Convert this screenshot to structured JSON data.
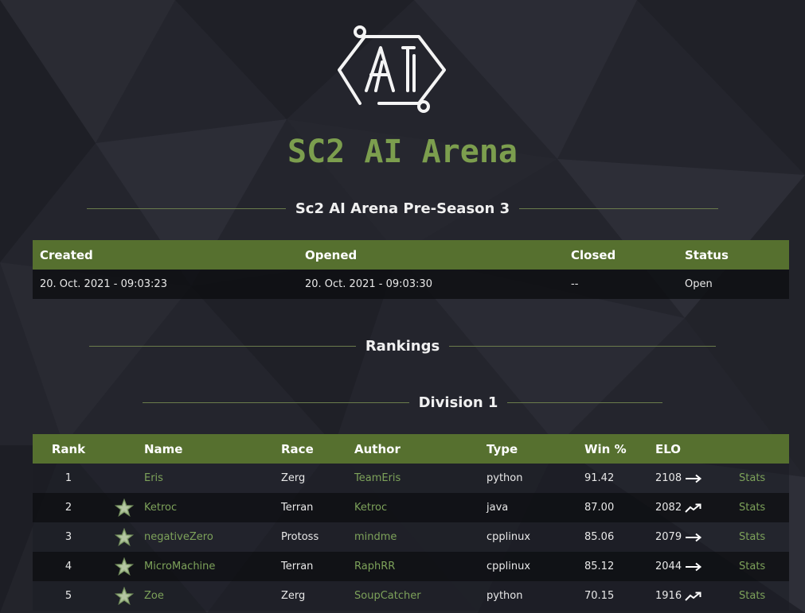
{
  "site": {
    "title": "SC2 AI Arena",
    "logo_text": "AI"
  },
  "season": {
    "title": "Sc2 AI Arena Pre-Season 3",
    "table": {
      "headers": {
        "created": "Created",
        "opened": "Opened",
        "closed": "Closed",
        "status": "Status"
      },
      "row": {
        "created": "20. Oct. 2021 - 09:03:23",
        "opened": "20. Oct. 2021 - 09:03:30",
        "closed": "--",
        "status": "Open"
      }
    }
  },
  "rankings": {
    "title": "Rankings"
  },
  "division": {
    "title": "Division 1",
    "headers": {
      "rank": "Rank",
      "name": "Name",
      "race": "Race",
      "author": "Author",
      "type": "Type",
      "win": "Win %",
      "elo": "ELO"
    },
    "rows": [
      {
        "rank": "1",
        "starred": false,
        "name": "Eris",
        "race": "Zerg",
        "author": "TeamEris",
        "type": "python",
        "win": "91.42",
        "elo": "2108",
        "trend": "flat-arrow-icon",
        "stats": "Stats"
      },
      {
        "rank": "2",
        "starred": true,
        "name": "Ketroc",
        "race": "Terran",
        "author": "Ketroc",
        "type": "java",
        "win": "87.00",
        "elo": "2082",
        "trend": "trending-up-icon",
        "stats": "Stats"
      },
      {
        "rank": "3",
        "starred": true,
        "name": "negativeZero",
        "race": "Protoss",
        "author": "mindme",
        "type": "cpplinux",
        "win": "85.06",
        "elo": "2079",
        "trend": "flat-arrow-icon",
        "stats": "Stats"
      },
      {
        "rank": "4",
        "starred": true,
        "name": "MicroMachine",
        "race": "Terran",
        "author": "RaphRR",
        "type": "cpplinux",
        "win": "85.12",
        "elo": "2044",
        "trend": "flat-arrow-icon",
        "stats": "Stats"
      },
      {
        "rank": "5",
        "starred": true,
        "name": "Zoe",
        "race": "Zerg",
        "author": "SoupCatcher",
        "type": "python",
        "win": "70.15",
        "elo": "1916",
        "trend": "trending-up-icon",
        "stats": "Stats"
      }
    ]
  },
  "colors": {
    "accent": "#7c9e4e",
    "header_bg": "#56702f",
    "link": "#7da25a",
    "background": "#23242c"
  }
}
